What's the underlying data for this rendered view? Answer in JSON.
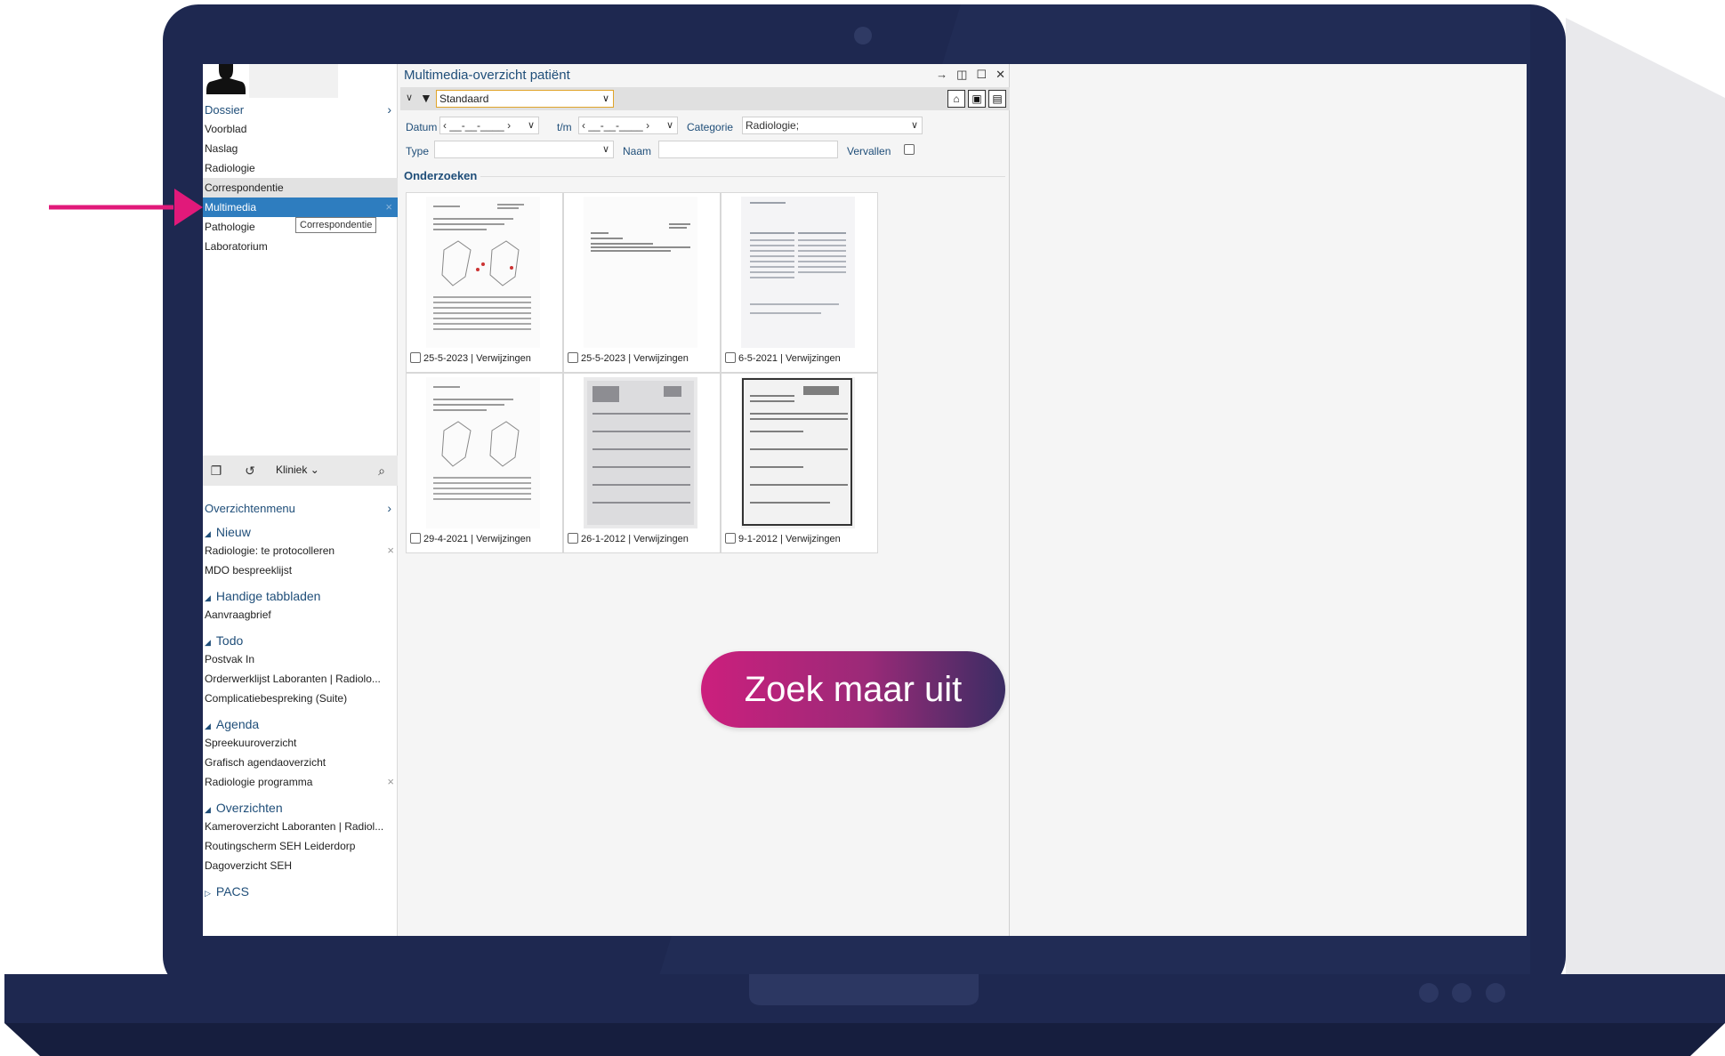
{
  "sidebar": {
    "dossier_label": "Dossier",
    "nav_items": [
      "Voorblad",
      "Naslag",
      "Radiologie",
      "Correspondentie",
      "Multimedia",
      "Pathologie",
      "Laboratorium"
    ],
    "tooltip": "Correspondentie",
    "toolbar": {
      "kliniek_label": "Kliniek"
    },
    "overzichtenmenu_label": "Overzichtenmenu",
    "groups": {
      "nieuw": {
        "title": "Nieuw",
        "items": [
          "Radiologie: te protocolleren",
          "MDO bespreeklijst"
        ]
      },
      "handige": {
        "title": "Handige tabbladen",
        "items": [
          "Aanvraagbrief"
        ]
      },
      "todo": {
        "title": "Todo",
        "items": [
          "Postvak In",
          "Orderwerklijst Laboranten | Radiolo...",
          "Complicatiebespreking (Suite)"
        ]
      },
      "agenda": {
        "title": "Agenda",
        "items": [
          "Spreekuuroverzicht",
          "Grafisch agendaoverzicht",
          "Radiologie programma"
        ]
      },
      "overzichten": {
        "title": "Overzichten",
        "items": [
          "Kameroverzicht Laboranten | Radiol...",
          "Routingscherm SEH Leiderdorp",
          "Dagoverzicht SEH"
        ]
      },
      "pacs": {
        "title": "PACS"
      }
    }
  },
  "panel": {
    "title": "Multimedia-overzicht patiënt",
    "filter_select": "Standaard",
    "labels": {
      "datum": "Datum",
      "tm": "t/m",
      "categorie": "Categorie",
      "type": "Type",
      "naam": "Naam",
      "vervallen": "Vervallen"
    },
    "date_from": "__-__-____",
    "date_to": "__-__-____",
    "categorie_value": "Radiologie;",
    "type_value": "",
    "naam_value": "",
    "section_title": "Onderzoeken",
    "documents": [
      "25-5-2023 | Verwijzingen",
      "25-5-2023 | Verwijzingen",
      "6-5-2021 | Verwijzingen",
      "29-4-2021 | Verwijzingen",
      "26-1-2012 | Verwijzingen",
      "9-1-2012 | Verwijzingen"
    ]
  },
  "cta": {
    "label": "Zoek maar uit"
  },
  "colors": {
    "laptop_frame": "#1e2850",
    "accent_pink": "#e1197a",
    "nav_active": "#2e7dbf",
    "heading_blue": "#1f4e79"
  }
}
